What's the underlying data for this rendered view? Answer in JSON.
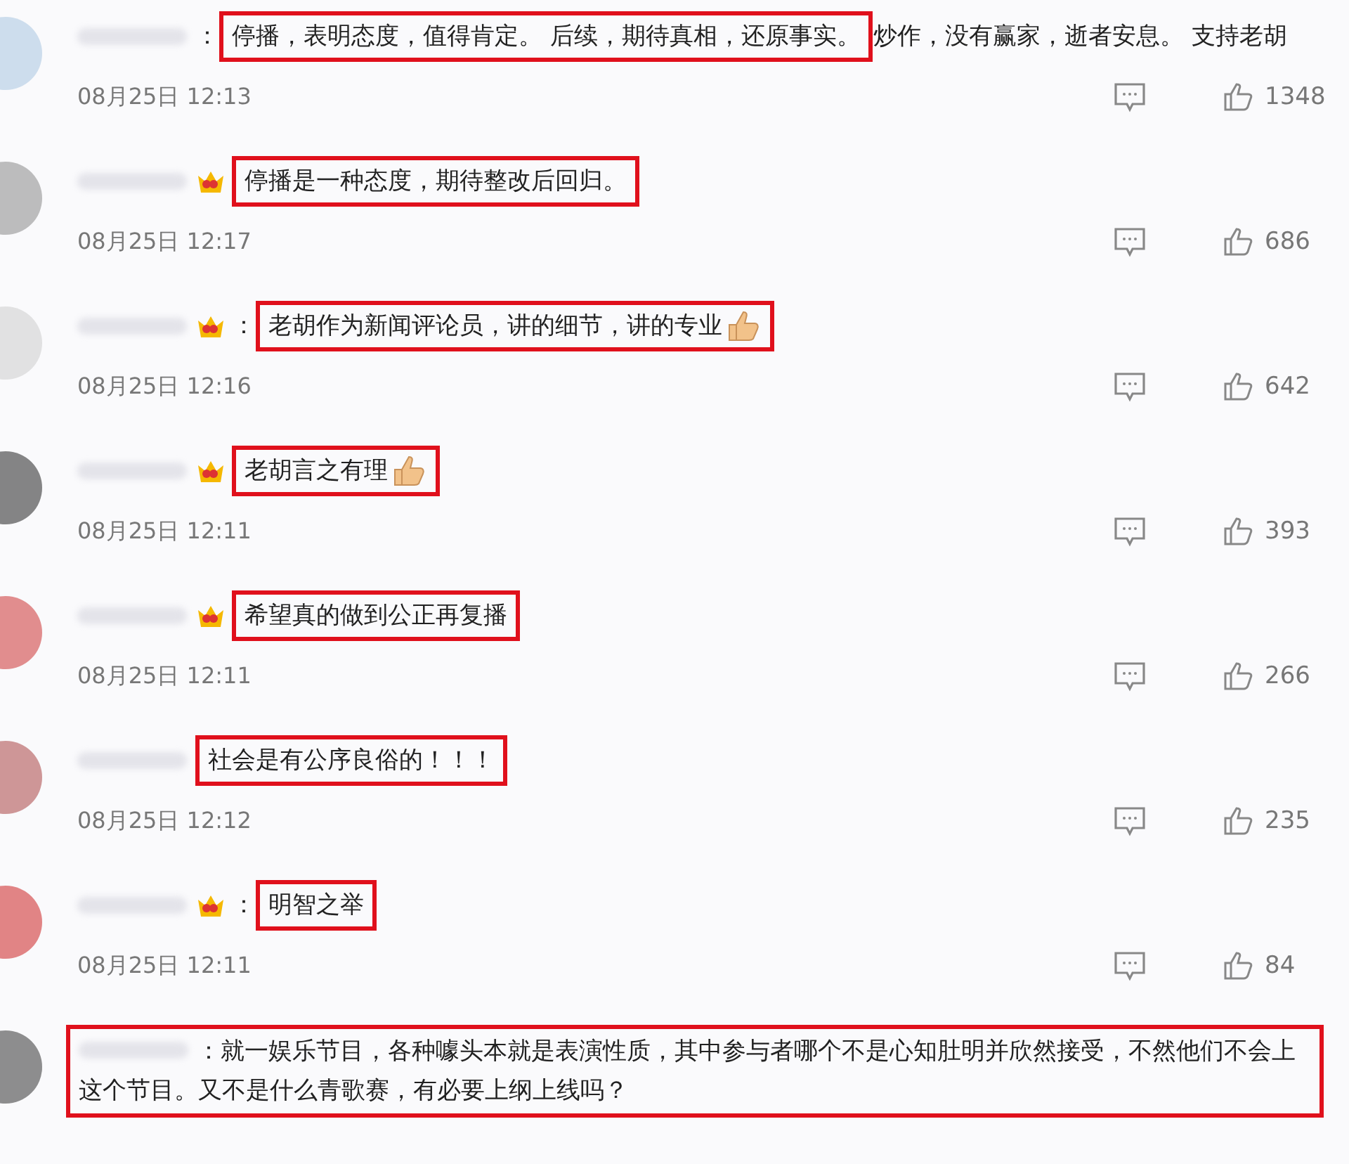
{
  "comments": [
    {
      "kind": "inline",
      "badge": false,
      "thumb_emoji": false,
      "segments": [
        {
          "text": "：",
          "highlighted": false
        },
        {
          "text": "停播，表明态度，值得肯定。 后续，期待真相，还原事实。",
          "highlighted": true
        },
        {
          "text": "炒作，没有赢家，逝者安息。 支持老胡",
          "highlighted": false
        }
      ],
      "time": "08月25日 12:13",
      "likes": "1348"
    },
    {
      "kind": "inline",
      "badge": true,
      "thumb_emoji": false,
      "segments": [
        {
          "text": "停播是一种态度，期待整改后回归。",
          "highlighted": true
        }
      ],
      "time": "08月25日 12:17",
      "likes": "686"
    },
    {
      "kind": "inline",
      "badge": true,
      "thumb_emoji": true,
      "segments": [
        {
          "text": "：",
          "highlighted": false
        },
        {
          "text": "老胡作为新闻评论员，讲的细节，讲的专业",
          "highlighted": true
        }
      ],
      "time": "08月25日 12:16",
      "likes": "642"
    },
    {
      "kind": "inline",
      "badge": true,
      "thumb_emoji": true,
      "segments": [
        {
          "text": "老胡言之有理",
          "highlighted": true
        }
      ],
      "time": "08月25日 12:11",
      "likes": "393"
    },
    {
      "kind": "inline",
      "badge": true,
      "thumb_emoji": false,
      "segments": [
        {
          "text": "希望真的做到公正再复播",
          "highlighted": true
        }
      ],
      "time": "08月25日 12:11",
      "likes": "266"
    },
    {
      "kind": "inline",
      "badge": false,
      "thumb_emoji": false,
      "segments": [
        {
          "text": "社会是有公序良俗的！！！",
          "highlighted": true
        }
      ],
      "time": "08月25日 12:12",
      "likes": "235"
    },
    {
      "kind": "inline",
      "badge": true,
      "thumb_emoji": false,
      "segments": [
        {
          "text": "：",
          "highlighted": false
        },
        {
          "text": "明智之举",
          "highlighted": true
        }
      ],
      "time": "08月25日 12:11",
      "likes": "84"
    },
    {
      "kind": "boxed",
      "segments": [
        {
          "text": "：就一娱乐节目，各种噱头本就是表演性质，其中参与者哪个不是心知肚明并欣然接受，不然他们不会上这个节目。又不是什么青歌赛，有必要上纲上线吗？"
        }
      ]
    }
  ]
}
